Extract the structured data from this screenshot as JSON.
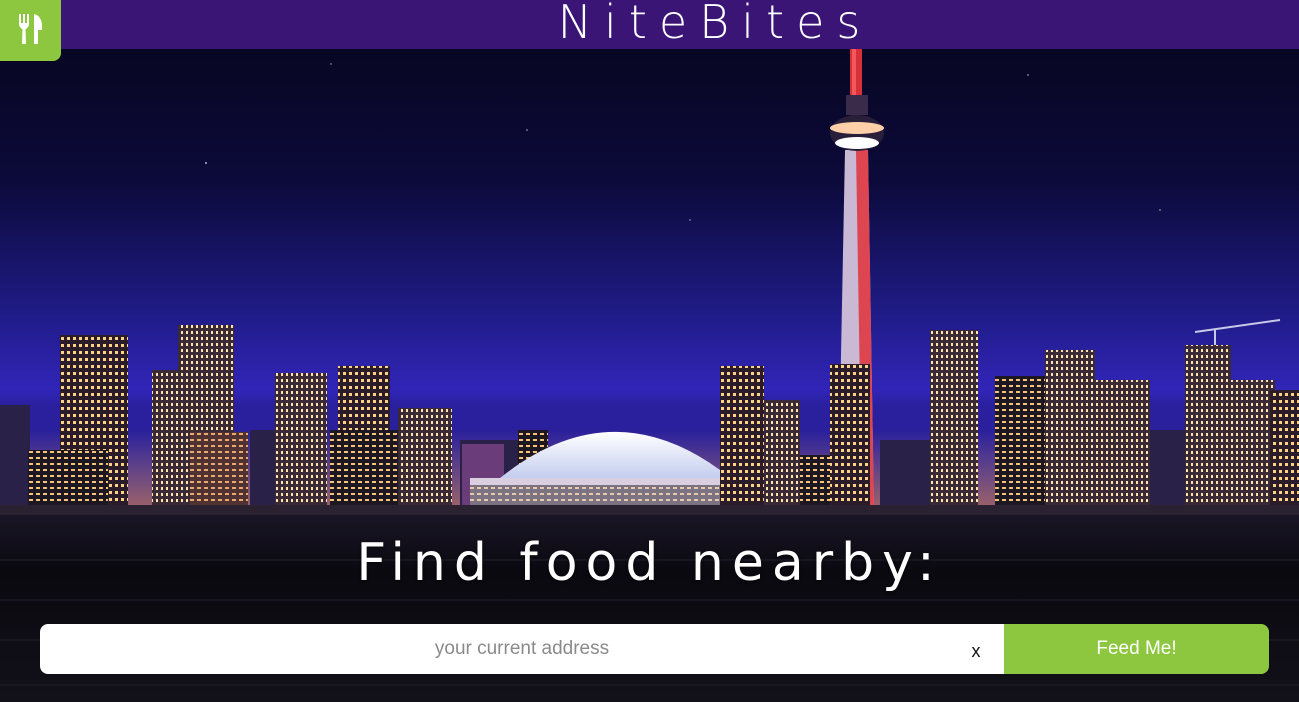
{
  "header": {
    "brand": "NiteBites",
    "logo_icon": "fork-knife-icon",
    "bar_color": "#3a1576",
    "accent_color": "#8dc63f"
  },
  "hero": {
    "background": "toronto-night-skyline-photo",
    "headline": "Find food nearby:"
  },
  "search": {
    "placeholder": "your current address",
    "value": "",
    "clear_label": "x",
    "submit_label": "Feed Me!"
  }
}
